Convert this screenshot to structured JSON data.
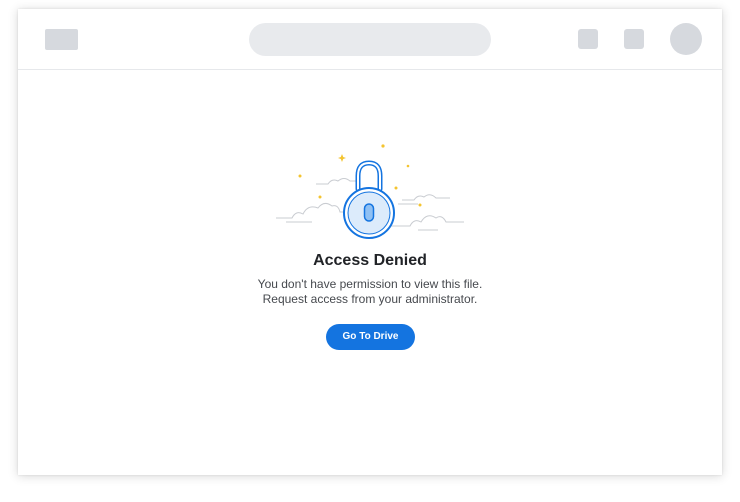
{
  "colors": {
    "accent": "#1474e0",
    "placeholder": "#d6d9de",
    "lock_fill": "#dcebfb",
    "lock_stroke": "#1474e0",
    "sparkle": "#f4c430",
    "cloud": "#c9ccd1"
  },
  "header": {
    "logo_icon": "logo-placeholder",
    "search_icon": "search-placeholder",
    "action_icons": [
      "action-placeholder",
      "action-placeholder"
    ],
    "avatar_icon": "avatar-placeholder"
  },
  "main": {
    "illustration_icon": "padlock-icon",
    "title": "Access Denied",
    "message_line1": "You don't have permission to view this file.",
    "message_line2": "Request access from your administrator.",
    "button_label": "Go To Drive"
  }
}
